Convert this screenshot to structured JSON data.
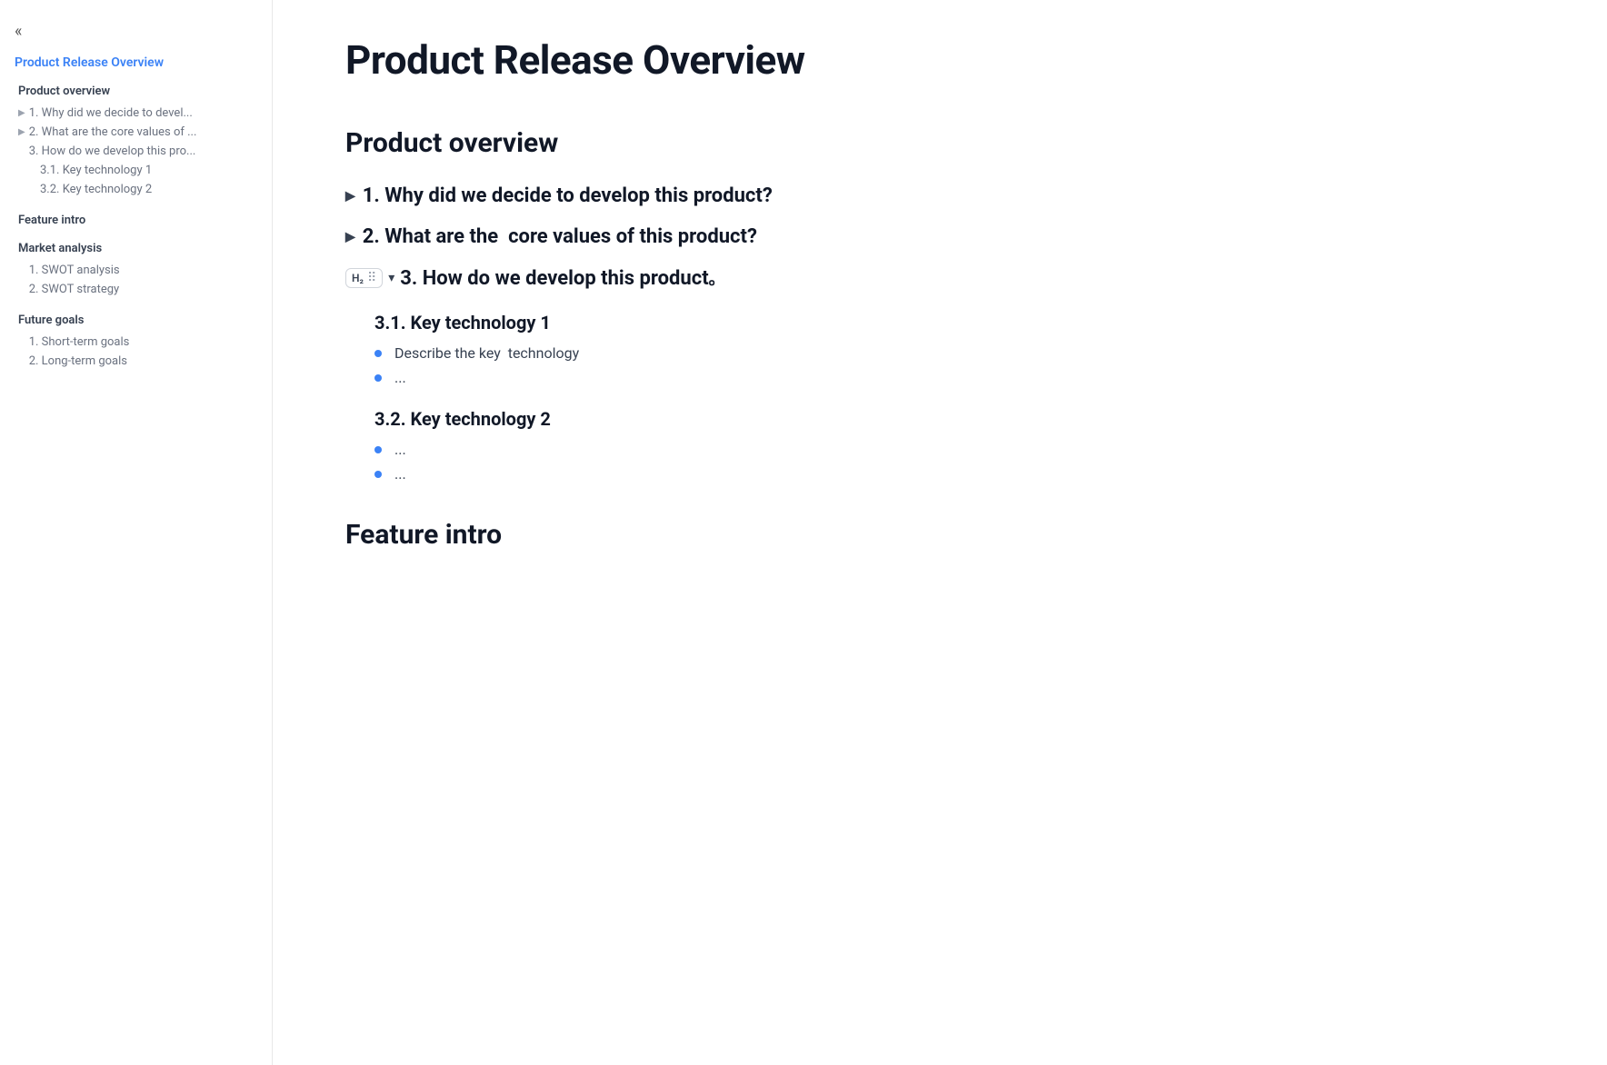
{
  "sidebar": {
    "back_icon": "«",
    "title": "Product Release Overview",
    "sections": [
      {
        "label": "Product overview",
        "items": [
          {
            "id": "item-1",
            "text": "1. Why did we decide to devel...",
            "indent": 1,
            "has_arrow": true
          },
          {
            "id": "item-2",
            "text": "2. What are the core values of ...",
            "indent": 1,
            "has_arrow": true
          },
          {
            "id": "item-3",
            "text": "3. How do we develop this pro...",
            "indent": 1,
            "has_arrow": false
          },
          {
            "id": "item-3-1",
            "text": "3.1. Key technology 1",
            "indent": 2,
            "has_arrow": false
          },
          {
            "id": "item-3-2",
            "text": "3.2. Key technology 2",
            "indent": 2,
            "has_arrow": false
          }
        ]
      },
      {
        "label": "Feature intro",
        "items": []
      },
      {
        "label": "Market analysis",
        "items": [
          {
            "id": "ma-1",
            "text": "1. SWOT analysis",
            "indent": 1,
            "has_arrow": false
          },
          {
            "id": "ma-2",
            "text": "2. SWOT strategy",
            "indent": 1,
            "has_arrow": false
          }
        ]
      },
      {
        "label": "Future goals",
        "items": [
          {
            "id": "fg-1",
            "text": "1. Short-term goals",
            "indent": 1,
            "has_arrow": false
          },
          {
            "id": "fg-2",
            "text": "2. Long-term goals",
            "indent": 1,
            "has_arrow": false
          }
        ]
      }
    ]
  },
  "main": {
    "page_title": "Product Release Overview",
    "product_overview_section": {
      "heading": "Product overview",
      "items": [
        {
          "id": "q1",
          "text": "1. Why did we decide to develop this product?",
          "collapsed": true
        },
        {
          "id": "q2",
          "text": "2. What are the  core values of this product?",
          "collapsed": true
        },
        {
          "id": "q3",
          "text": "3. How do we develop this product",
          "trailing": "。",
          "collapsed": false,
          "toolbar_label": "H₂",
          "sub_sections": [
            {
              "id": "q3-1",
              "heading": "3.1. Key technology 1",
              "bullets": [
                "Describe the key  technology",
                "..."
              ]
            },
            {
              "id": "q3-2",
              "heading": "3.2. Key technology 2",
              "bullets": [
                "...",
                "..."
              ]
            }
          ]
        }
      ]
    },
    "feature_intro": {
      "heading": "Feature intro"
    }
  },
  "icons": {
    "back": "«",
    "arrow_right": "▶",
    "arrow_down": "▾",
    "dots": "⋮"
  }
}
